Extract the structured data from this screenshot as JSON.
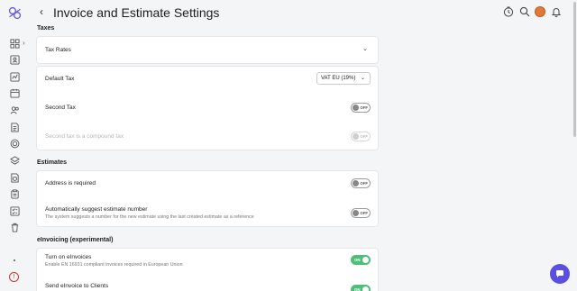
{
  "header": {
    "back_label": "‹",
    "title": "Invoice and Estimate Settings"
  },
  "sidebar": {
    "expand_label": "›",
    "icons": [
      "dashboard-icon",
      "contact-card-icon",
      "chart-icon",
      "calendar-icon",
      "users-icon",
      "document-icon",
      "target-icon",
      "layers-icon",
      "clock-document-icon",
      "clipboard-icon",
      "checklist-icon",
      "trash-icon"
    ],
    "help_label": "!"
  },
  "sections": {
    "taxes": {
      "title": "Taxes",
      "tax_rates_label": "Tax Rates",
      "default_tax_label": "Default Tax",
      "default_tax_value": "VAT EU (19%)",
      "second_tax_label": "Second Tax",
      "second_tax_toggle": "OFF",
      "compound_label": "Second tax is a compound tax",
      "compound_toggle": "OFF"
    },
    "estimates": {
      "title": "Estimates",
      "address_label": "Address is required",
      "address_toggle": "OFF",
      "suggest_label": "Automatically suggest estimate number",
      "suggest_desc": "The system suggests a number for the new estimate using the last created estimate as a reference",
      "suggest_toggle": "OFF"
    },
    "einvoicing": {
      "title": "eInvoicing (experimental)",
      "turn_on_label": "Turn on eInvoices",
      "turn_on_desc": "Enable EN 16931 compliant invoices required in European Union",
      "turn_on_toggle": "ON",
      "send_label": "Send eInvoice to Clients",
      "send_toggle": "ON"
    }
  },
  "colors": {
    "toggle_on": "#4cbf7a",
    "chat": "#5b4fe3",
    "avatar": "#e07a3a"
  }
}
